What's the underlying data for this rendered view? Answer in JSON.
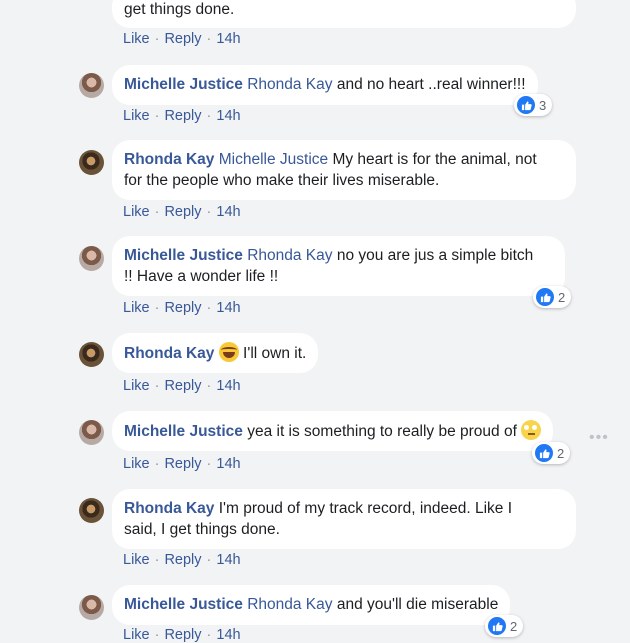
{
  "comments": [
    {
      "text": "get things done.",
      "actions": {
        "like": "Like",
        "reply": "Reply",
        "time": "14h"
      }
    },
    {
      "author": "Michelle Justice",
      "mention": "Rhonda Kay",
      "text": " and no heart ..real winner!!!",
      "actions": {
        "like": "Like",
        "reply": "Reply",
        "time": "14h"
      },
      "reaction_count": "3"
    },
    {
      "author": "Rhonda Kay",
      "mention": "Michelle Justice",
      "text_line1": " My heart is for the animal, not",
      "text_line2": "for the people who make their lives miserable.",
      "actions": {
        "like": "Like",
        "reply": "Reply",
        "time": "14h"
      }
    },
    {
      "author": "Michelle Justice",
      "mention": "Rhonda Kay",
      "text_line1": " no you are jus a simple bitch",
      "text_line2": "!! Have a wonder life !!",
      "actions": {
        "like": "Like",
        "reply": "Reply",
        "time": "14h"
      },
      "reaction_count": "2"
    },
    {
      "author": "Rhonda Kay",
      "text": " I'll own it.",
      "emoji": "laughing-tears-emoji",
      "actions": {
        "like": "Like",
        "reply": "Reply",
        "time": "14h"
      }
    },
    {
      "author": "Michelle Justice",
      "text": " yea it is something to really be proud of ",
      "emoji": "eye-roll-emoji",
      "actions": {
        "like": "Like",
        "reply": "Reply",
        "time": "14h"
      },
      "reaction_count": "2"
    },
    {
      "author": "Rhonda Kay",
      "text_line1": " I'm proud of my track record, indeed. Like I",
      "text_line2": "said, I get things done.",
      "actions": {
        "like": "Like",
        "reply": "Reply",
        "time": "14h"
      }
    },
    {
      "author": "Michelle Justice",
      "mention": "Rhonda Kay",
      "text": " and you'll die miserable",
      "actions": {
        "like": "Like",
        "reply": "Reply",
        "time": "14h"
      },
      "reaction_count": "2"
    }
  ],
  "more_label": "•••",
  "colors": {
    "link": "#385898",
    "like_blue": "#2078f4",
    "bubble": "#ffffff",
    "background": "#f2f3f5"
  }
}
